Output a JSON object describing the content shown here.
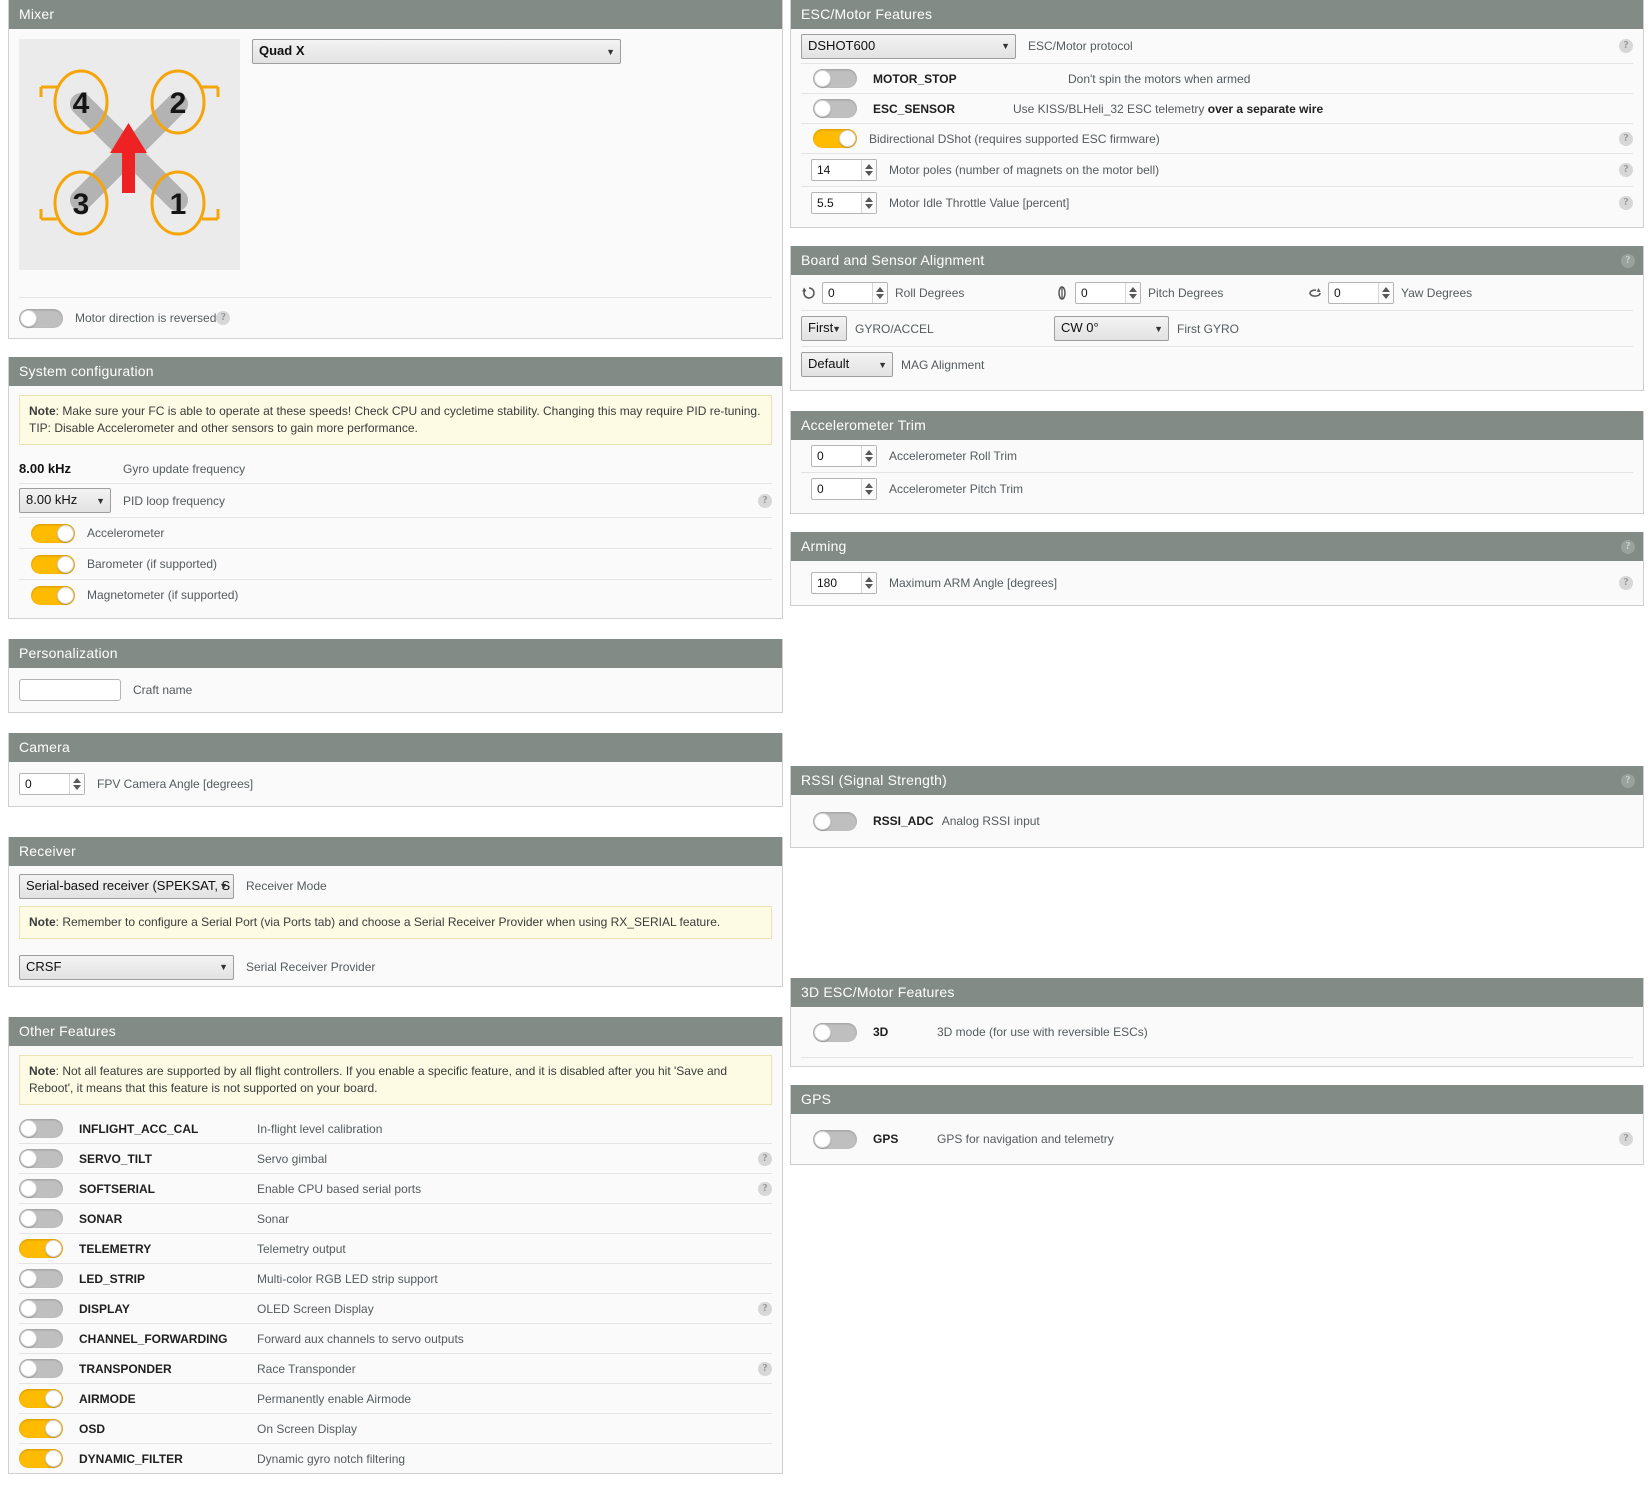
{
  "mixer": {
    "title": "Mixer",
    "selected_type": "Quad X",
    "motor_numbers": [
      "1",
      "2",
      "3",
      "4"
    ],
    "reverse_toggle": {
      "label": "Motor direction is reversed",
      "on": false
    },
    "help_icon": "?"
  },
  "system_configuration": {
    "title": "System configuration",
    "note_prefix": "Note",
    "note": ": Make sure your FC is able to operate at these speeds! Check CPU and cycletime stability. Changing this may require PID re-tuning. TIP: Disable Accelerometer and other sensors to gain more performance.",
    "gyro_update_value": "8.00 kHz",
    "gyro_update_label": "Gyro update frequency",
    "pid_loop_value": "8.00 kHz",
    "pid_loop_label": "PID loop frequency",
    "toggles": [
      {
        "label": "Accelerometer",
        "on": true
      },
      {
        "label": "Barometer (if supported)",
        "on": true
      },
      {
        "label": "Magnetometer (if supported)",
        "on": true
      }
    ]
  },
  "personalization": {
    "title": "Personalization",
    "craft_name_value": "",
    "craft_name_placeholder": "",
    "craft_name_label": "Craft name"
  },
  "camera": {
    "title": "Camera",
    "fpv_angle_value": "0",
    "fpv_angle_label": "FPV Camera Angle [degrees]"
  },
  "receiver": {
    "title": "Receiver",
    "mode_value": "Serial-based receiver (SPEKSAT, S",
    "mode_label": "Receiver Mode",
    "note_prefix": "Note",
    "note": ": Remember to configure a Serial Port (via Ports tab) and choose a Serial Receiver Provider when using RX_SERIAL feature.",
    "provider_value": "CRSF",
    "provider_label": "Serial Receiver Provider"
  },
  "other_features": {
    "title": "Other Features",
    "note_prefix": "Note",
    "note": ": Not all features are supported by all flight controllers. If you enable a specific feature, and it is disabled after you hit 'Save and Reboot', it means that this feature is not supported on your board.",
    "features": [
      {
        "name": "INFLIGHT_ACC_CAL",
        "desc": "In-flight level calibration",
        "on": false,
        "help": false
      },
      {
        "name": "SERVO_TILT",
        "desc": "Servo gimbal",
        "on": false,
        "help": true
      },
      {
        "name": "SOFTSERIAL",
        "desc": "Enable CPU based serial ports",
        "on": false,
        "help": true
      },
      {
        "name": "SONAR",
        "desc": "Sonar",
        "on": false,
        "help": false
      },
      {
        "name": "TELEMETRY",
        "desc": "Telemetry output",
        "on": true,
        "help": false
      },
      {
        "name": "LED_STRIP",
        "desc": "Multi-color RGB LED strip support",
        "on": false,
        "help": false
      },
      {
        "name": "DISPLAY",
        "desc": "OLED Screen Display",
        "on": false,
        "help": true
      },
      {
        "name": "CHANNEL_FORWARDING",
        "desc": "Forward aux channels to servo outputs",
        "on": false,
        "help": false
      },
      {
        "name": "TRANSPONDER",
        "desc": "Race Transponder",
        "on": false,
        "help": true
      },
      {
        "name": "AIRMODE",
        "desc": "Permanently enable Airmode",
        "on": true,
        "help": false
      },
      {
        "name": "OSD",
        "desc": "On Screen Display",
        "on": true,
        "help": false
      },
      {
        "name": "DYNAMIC_FILTER",
        "desc": "Dynamic gyro notch filtering",
        "on": true,
        "help": false
      }
    ]
  },
  "esc_motor_features": {
    "title": "ESC/Motor Features",
    "protocol_value": "DSHOT600",
    "protocol_label": "ESC/Motor protocol",
    "motor_stop": {
      "name": "MOTOR_STOP",
      "desc": "Don't spin the motors when armed",
      "on": false
    },
    "esc_sensor": {
      "name": "ESC_SENSOR",
      "desc_1": "Use KISS/BLHeli_32 ESC telemetry ",
      "desc_bold": "over a separate wire",
      "on": false
    },
    "bidir_dshot": {
      "label": "Bidirectional DShot (requires supported ESC firmware)",
      "on": true
    },
    "motor_poles": {
      "value": "14",
      "label": "Motor poles (number of magnets on the motor bell)"
    },
    "motor_idle": {
      "value": "5.5",
      "label": "Motor Idle Throttle Value [percent]"
    }
  },
  "board_alignment": {
    "title": "Board and Sensor Alignment",
    "roll": {
      "value": "0",
      "label": "Roll Degrees"
    },
    "pitch": {
      "value": "0",
      "label": "Pitch Degrees"
    },
    "yaw": {
      "value": "0",
      "label": "Yaw Degrees"
    },
    "gyro_accel_select": "First",
    "gyro_accel_label": "GYRO/ACCEL",
    "first_gyro_select": "CW 0°",
    "first_gyro_label": "First GYRO",
    "mag_select": "Default",
    "mag_label": "MAG Alignment"
  },
  "accelerometer_trim": {
    "title": "Accelerometer Trim",
    "roll_trim": {
      "value": "0",
      "label": "Accelerometer Roll Trim"
    },
    "pitch_trim": {
      "value": "0",
      "label": "Accelerometer Pitch Trim"
    }
  },
  "arming": {
    "title": "Arming",
    "max_arm_angle": {
      "value": "180",
      "label": "Maximum ARM Angle [degrees]"
    }
  },
  "rssi": {
    "title": "RSSI (Signal Strength)",
    "rssi_adc": {
      "name": "RSSI_ADC",
      "desc": "Analog RSSI input",
      "on": false
    }
  },
  "esc_3d": {
    "title": "3D ESC/Motor Features",
    "three_d": {
      "name": "3D",
      "desc": "3D mode (for use with reversible ESCs)",
      "on": false
    }
  },
  "gps": {
    "title": "GPS",
    "gps_toggle": {
      "name": "GPS",
      "desc": "GPS for navigation and telemetry",
      "on": false
    }
  },
  "colors": {
    "panel_header": "#828b85",
    "toggle_on": "#ffbb00",
    "note_bg": "#fdfbe4",
    "arrow_red": "#ee2222",
    "motor_ring": "#f5a50a"
  }
}
